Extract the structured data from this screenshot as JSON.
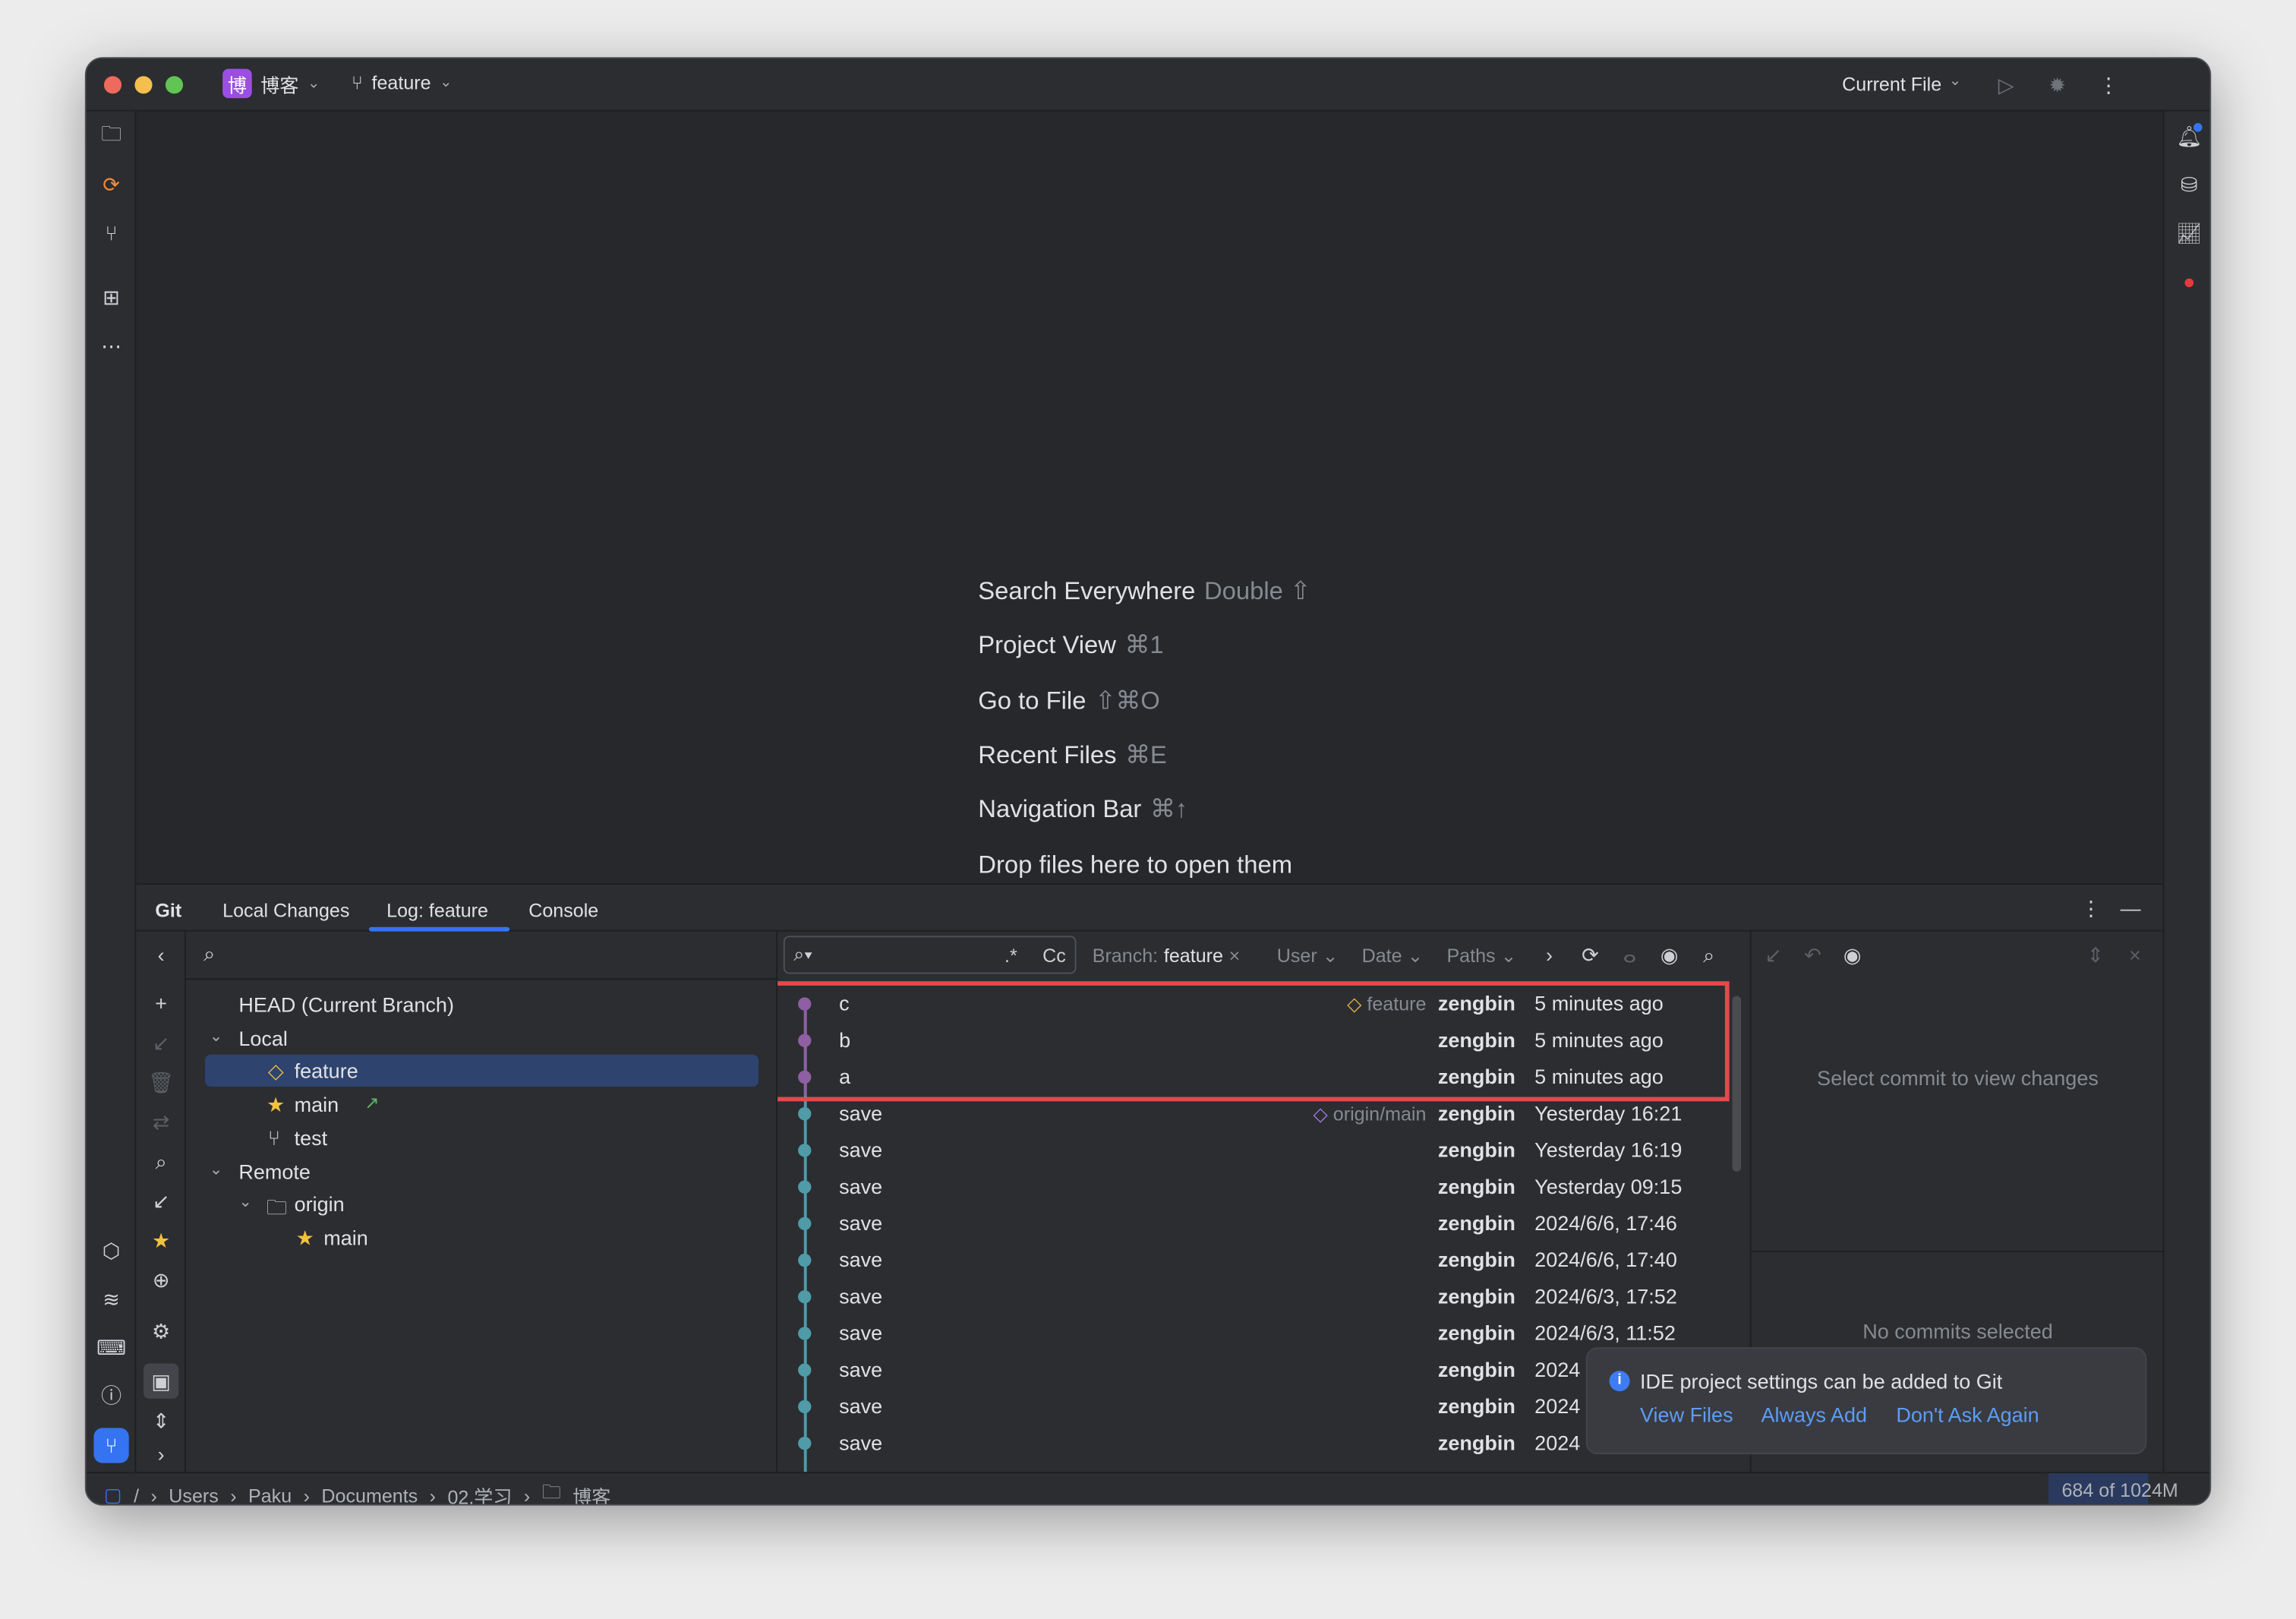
{
  "titlebar": {
    "project_badge": "博",
    "project": "博客",
    "branch": "feature",
    "run_config": "Current File"
  },
  "welcome": [
    {
      "label": "Search Everywhere",
      "shortcut": "Double ⇧"
    },
    {
      "label": "Project View",
      "shortcut": "⌘1"
    },
    {
      "label": "Go to File",
      "shortcut": "⇧⌘O"
    },
    {
      "label": "Recent Files",
      "shortcut": "⌘E"
    },
    {
      "label": "Navigation Bar",
      "shortcut": "⌘↑"
    },
    {
      "label": "Drop files here to open them",
      "shortcut": ""
    }
  ],
  "git": {
    "tabs": [
      "Git",
      "Local Changes",
      "Log: feature",
      "Console"
    ],
    "active_tab": "Log: feature",
    "tree": {
      "head": "HEAD (Current Branch)",
      "local": "Local",
      "local_branches": [
        "feature",
        "main",
        "test"
      ],
      "remote": "Remote",
      "origin": "origin",
      "remote_branches": [
        "main"
      ]
    },
    "filters": {
      "regex": ".*",
      "case": "Cc",
      "branch_label": "Branch:",
      "branch_value": "feature",
      "user": "User",
      "date": "Date",
      "paths": "Paths"
    },
    "commits": [
      {
        "message": "c",
        "ref": "feature",
        "author": "zengbin",
        "date": "5 minutes ago",
        "color": "#8e5fa3"
      },
      {
        "message": "b",
        "ref": "",
        "author": "zengbin",
        "date": "5 minutes ago",
        "color": "#8e5fa3"
      },
      {
        "message": "a",
        "ref": "",
        "author": "zengbin",
        "date": "5 minutes ago",
        "color": "#8e5fa3"
      },
      {
        "message": "save",
        "ref": "origin/main",
        "author": "zengbin",
        "date": "Yesterday 16:21",
        "color": "#4f9ba8"
      },
      {
        "message": "save",
        "ref": "",
        "author": "zengbin",
        "date": "Yesterday 16:19",
        "color": "#4f9ba8"
      },
      {
        "message": "save",
        "ref": "",
        "author": "zengbin",
        "date": "Yesterday 09:15",
        "color": "#4f9ba8"
      },
      {
        "message": "save",
        "ref": "",
        "author": "zengbin",
        "date": "2024/6/6, 17:46",
        "color": "#4f9ba8"
      },
      {
        "message": "save",
        "ref": "",
        "author": "zengbin",
        "date": "2024/6/6, 17:40",
        "color": "#4f9ba8"
      },
      {
        "message": "save",
        "ref": "",
        "author": "zengbin",
        "date": "2024/6/3, 17:52",
        "color": "#4f9ba8"
      },
      {
        "message": "save",
        "ref": "",
        "author": "zengbin",
        "date": "2024/6/3, 11:52",
        "color": "#4f9ba8"
      },
      {
        "message": "save",
        "ref": "",
        "author": "zengbin",
        "date": "2024",
        "color": "#4f9ba8"
      },
      {
        "message": "save",
        "ref": "",
        "author": "zengbin",
        "date": "2024",
        "color": "#4f9ba8"
      },
      {
        "message": "save",
        "ref": "",
        "author": "zengbin",
        "date": "2024",
        "color": "#4f9ba8"
      }
    ],
    "details_empty": "Select commit to view changes",
    "no_commits": "No commits selected"
  },
  "notification": {
    "text": "IDE project settings can be added to Git",
    "actions": [
      "View Files",
      "Always Add",
      "Don't Ask Again"
    ]
  },
  "statusbar": {
    "breadcrumb": [
      "/",
      "Users",
      "Paku",
      "Documents",
      "02.学习",
      "博客"
    ],
    "memory": "684 of 1024M",
    "memory_fraction": 0.668
  },
  "colors": {
    "accent": "#3574f0",
    "highlight_box": "#e5484d",
    "selection": "#2e436e",
    "link": "#5e9cf5"
  }
}
